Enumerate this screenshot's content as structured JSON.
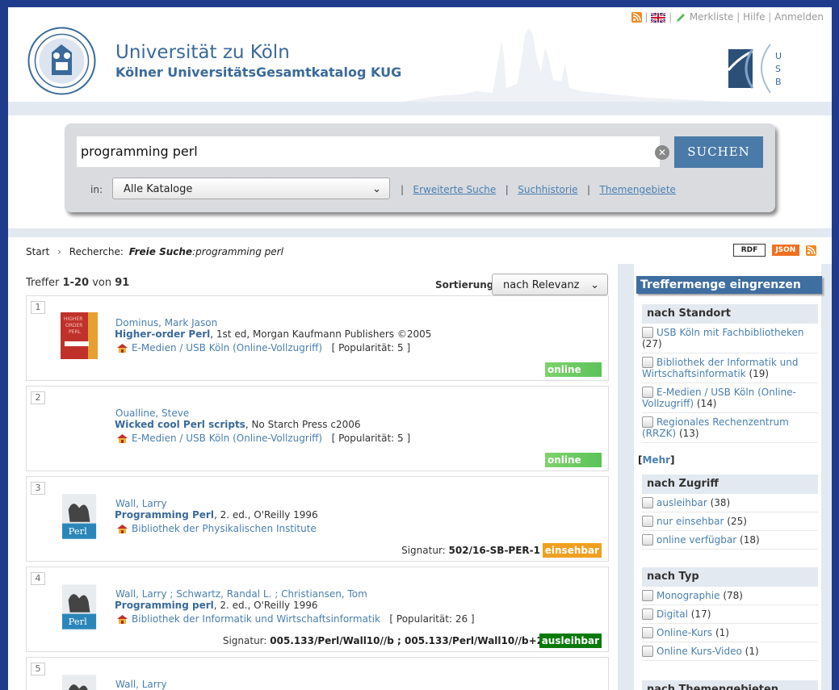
{
  "header": {
    "title": "Universität zu Köln",
    "subtitle": "Kölner UniversitätsGesamtkatalog KUG",
    "toplinks": [
      "Merkliste",
      "Hilfe",
      "Anmelden"
    ],
    "usb_logo_text": "USB"
  },
  "search": {
    "query": "programming perl",
    "button": "SUCHEN",
    "in_label": "in:",
    "catalog_select": "Alle Kataloge",
    "links": [
      "Erweiterte Suche",
      "Suchhistorie",
      "Themengebiete"
    ]
  },
  "breadcrumb": {
    "start": "Start",
    "recherche": "Recherche:",
    "mode": "Freie Suche",
    "query": ":programming perl"
  },
  "feeds": {
    "rdf": "RDF",
    "json": "JSON"
  },
  "results": {
    "prefix": "Treffer",
    "range": "1-20",
    "von": "von",
    "total": "91",
    "sort_label": "Sortierung:",
    "sort_value": "nach Relevanz",
    "items": [
      {
        "num": "1",
        "author": "Dominus, Mark Jason",
        "title": "Higher-order Perl",
        "details": ", 1st ed, Morgan Kaufmann Publishers ©2005",
        "location": "E-Medien / USB Köln (Online-Vollzugriff)",
        "pop": "[ Popularität: 5 ]",
        "status": "online",
        "signatur_label": "",
        "signatur": ""
      },
      {
        "num": "2",
        "author": "Oualline, Steve",
        "title": "Wicked cool Perl scripts",
        "details": ", No Starch Press c2006",
        "location": "E-Medien / USB Köln (Online-Vollzugriff)",
        "pop": "[ Popularität: 5 ]",
        "status": "online",
        "signatur_label": "",
        "signatur": ""
      },
      {
        "num": "3",
        "author": "Wall, Larry",
        "title": "Programming Perl",
        "details": ", 2. ed., O'Reilly 1996",
        "location": "Bibliothek der Physikalischen Institute",
        "pop": "",
        "status": "einsehbar",
        "signatur_label": "Signatur:",
        "signatur": "502/16-SB-PER-1"
      },
      {
        "num": "4",
        "author": "Wall, Larry",
        "author2": "Schwartz, Randal L.",
        "author3": "Christiansen, Tom",
        "title": "Programming perl",
        "details": ", 2. ed., O'Reilly 1996",
        "location": "Bibliothek der Informatik und Wirtschaftsinformatik",
        "pop": "[ Popularität: 26 ]",
        "status": "ausleihbar",
        "signatur_label": "Signatur:",
        "signatur": "005.133/Perl/Wall10//b ; 005.133/Perl/Wall10//b+2"
      },
      {
        "num": "5",
        "author": "Wall, Larry"
      }
    ]
  },
  "facets": {
    "heading": "Treffermenge eingrenzen",
    "more": "Mehr",
    "groups": [
      {
        "title": "nach Standort",
        "items": [
          {
            "label": "USB Köln mit Fachbibliotheken",
            "count": "(27)"
          },
          {
            "label": "Bibliothek der Informatik und Wirtschaftsinformatik",
            "count": "(19)"
          },
          {
            "label": "E-Medien / USB Köln (Online-Vollzugriff)",
            "count": "(14)"
          },
          {
            "label": "Regionales Rechenzentrum (RRZK)",
            "count": "(13)"
          }
        ]
      },
      {
        "title": "nach Zugriff",
        "items": [
          {
            "label": "ausleihbar",
            "count": "(38)"
          },
          {
            "label": "nur einsehbar",
            "count": "(25)"
          },
          {
            "label": "online verfügbar",
            "count": "(18)"
          }
        ]
      },
      {
        "title": "nach Typ",
        "items": [
          {
            "label": "Monographie",
            "count": "(78)"
          },
          {
            "label": "Digital",
            "count": "(17)"
          },
          {
            "label": "Online-Kurs",
            "count": "(1)"
          },
          {
            "label": "Online Kurs-Video",
            "count": "(1)"
          }
        ]
      },
      {
        "title": "nach Themengebieten",
        "items": []
      }
    ]
  },
  "colors": {
    "bg": "#1f3c8c",
    "brand": "#3b6a9a",
    "link": "#4a7fb0",
    "online": "#6ccb62",
    "einsehbar": "#f0a020",
    "ausleihbar": "#0a7a0a"
  }
}
